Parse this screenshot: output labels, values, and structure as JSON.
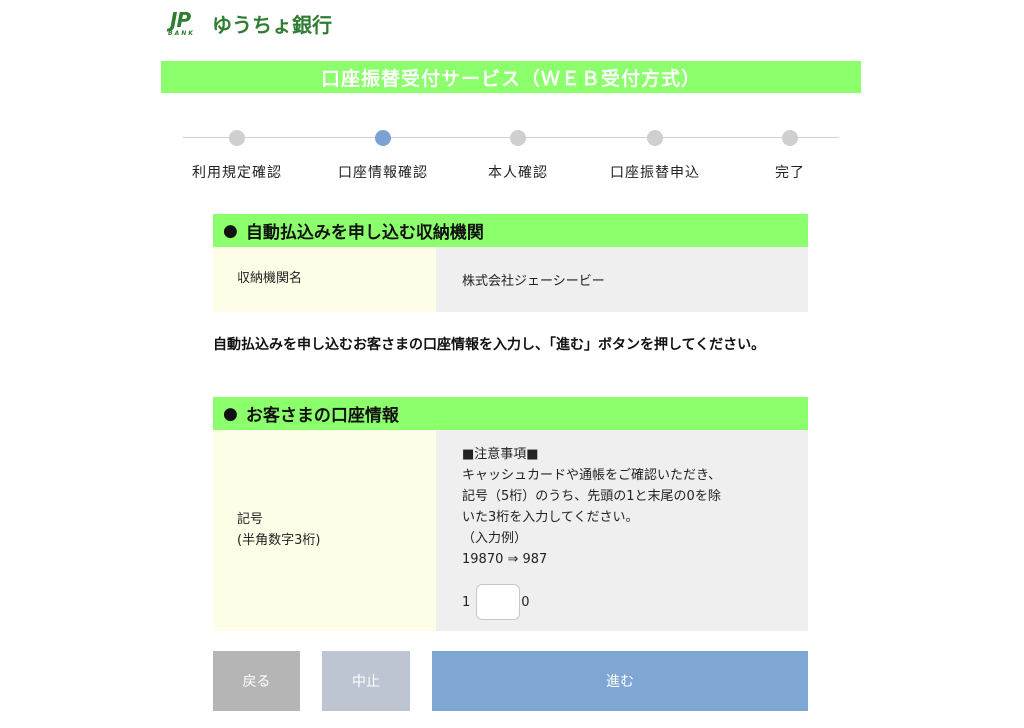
{
  "header": {
    "logo_mark": "JP",
    "logo_sub": "BANK",
    "bank_name": "ゆうちょ銀行"
  },
  "banner": {
    "title": "口座振替受付サービス（ＷＥＢ受付方式）"
  },
  "steps": [
    {
      "label": "利用規定確認",
      "active": false
    },
    {
      "label": "口座情報確認",
      "active": true
    },
    {
      "label": "本人確認",
      "active": false
    },
    {
      "label": "口座振替申込",
      "active": false
    },
    {
      "label": "完了",
      "active": false
    }
  ],
  "section1": {
    "bullet": "●",
    "title": "自動払込みを申し込む収納機関",
    "key": "収納機関名",
    "value": "株式会社ジェーシービー"
  },
  "instruction": "自動払込みを申し込むお客さまの口座情報を入力し、「進む」ボタンを押してください。",
  "section2": {
    "bullet": "●",
    "title": "お客さまの口座情報",
    "key_line1": "記号",
    "key_line2": "(半角数字3桁)",
    "notes": [
      "■注意事項■",
      "キャッシュカードや通帳をご確認いただき、",
      "記号（5桁）のうち、先頭の1と末尾の0を除",
      "いた3桁を入力してください。",
      "（入力例）",
      "19870 ⇒ 987"
    ],
    "prefix": "1",
    "suffix": "0",
    "input_value": ""
  },
  "buttons": {
    "back": "戻る",
    "cancel": "中止",
    "next": "進む"
  },
  "colors": {
    "accent_green": "#8cff6d",
    "logo_green": "#2e7d32",
    "active_step": "#7aa3d3",
    "key_bg": "#fefee8",
    "value_bg": "#efefef"
  }
}
